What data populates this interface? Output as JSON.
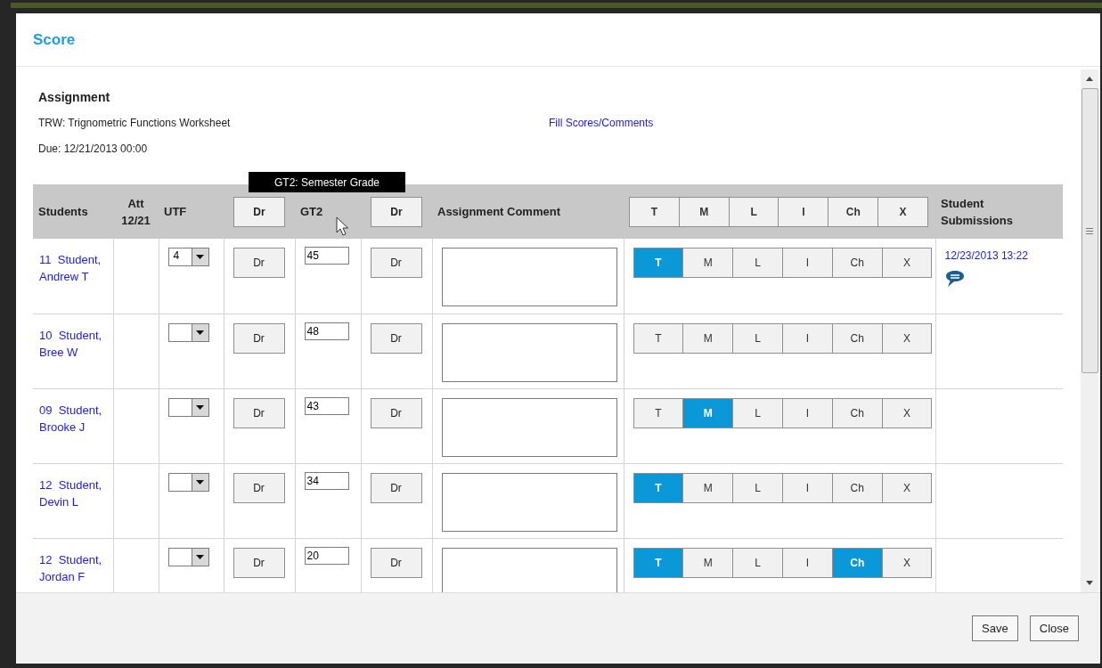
{
  "dialog": {
    "title": "Score"
  },
  "assignment": {
    "heading": "Assignment",
    "name": "TRW: Trignometric Functions Worksheet",
    "due": "Due: 12/21/2013 00:00",
    "fill_link": "Fill Scores/Comments"
  },
  "tooltip": "GT2: Semester Grade",
  "table": {
    "columns": [
      {
        "kind": "text",
        "label": "Students"
      },
      {
        "kind": "center",
        "label": "Att 12/21"
      },
      {
        "kind": "text",
        "label": "UTF"
      },
      {
        "kind": "button",
        "label": "Dr"
      },
      {
        "kind": "text",
        "label": "GT2"
      },
      {
        "kind": "button",
        "label": "Dr"
      },
      {
        "kind": "text",
        "label": "Assignment Comment"
      },
      {
        "kind": "buttons",
        "labels": [
          "T",
          "M",
          "L",
          "I",
          "Ch",
          "X"
        ]
      },
      {
        "kind": "text",
        "label": "Student Submissions"
      }
    ],
    "rows": [
      {
        "student": "11  Student, Andrew T",
        "utf": "4",
        "dr_left": "Dr",
        "score": "45",
        "dr_right": "Dr",
        "marks": [
          {
            "label": "T",
            "selected": true
          },
          {
            "label": "M",
            "selected": false
          },
          {
            "label": "L",
            "selected": false
          },
          {
            "label": "I",
            "selected": false
          },
          {
            "label": "Ch",
            "selected": false
          },
          {
            "label": "X",
            "selected": false
          }
        ],
        "submission": "12/23/2013 13:22",
        "has_comment": true
      },
      {
        "student": "10  Student, Bree W",
        "dr_left": "Dr",
        "score": "48",
        "dr_right": "Dr",
        "marks": [
          {
            "label": "T",
            "selected": false
          },
          {
            "label": "M",
            "selected": false
          },
          {
            "label": "L",
            "selected": false
          },
          {
            "label": "I",
            "selected": false
          },
          {
            "label": "Ch",
            "selected": false
          },
          {
            "label": "X",
            "selected": false
          }
        ],
        "has_comment": false
      },
      {
        "student": "09  Student, Brooke J",
        "dr_left": "Dr",
        "score": "43",
        "dr_right": "Dr",
        "marks": [
          {
            "label": "T",
            "selected": false
          },
          {
            "label": "M",
            "selected": true
          },
          {
            "label": "L",
            "selected": false
          },
          {
            "label": "I",
            "selected": false
          },
          {
            "label": "Ch",
            "selected": false
          },
          {
            "label": "X",
            "selected": false
          }
        ],
        "has_comment": false
      },
      {
        "student": "12  Student, Devin L",
        "dr_left": "Dr",
        "score": "34",
        "dr_right": "Dr",
        "marks": [
          {
            "label": "T",
            "selected": true
          },
          {
            "label": "M",
            "selected": false
          },
          {
            "label": "L",
            "selected": false
          },
          {
            "label": "I",
            "selected": false
          },
          {
            "label": "Ch",
            "selected": false
          },
          {
            "label": "X",
            "selected": false
          }
        ],
        "has_comment": false
      },
      {
        "student": "12  Student, Jordan F",
        "dr_left": "Dr",
        "score": "20",
        "dr_right": "Dr",
        "marks": [
          {
            "label": "T",
            "selected": true
          },
          {
            "label": "M",
            "selected": false
          },
          {
            "label": "L",
            "selected": false
          },
          {
            "label": "I",
            "selected": false
          },
          {
            "label": "Ch",
            "selected": true
          },
          {
            "label": "X",
            "selected": false
          }
        ],
        "has_comment": false
      }
    ]
  },
  "footer": {
    "buttons": [
      "Save",
      "Close"
    ]
  }
}
